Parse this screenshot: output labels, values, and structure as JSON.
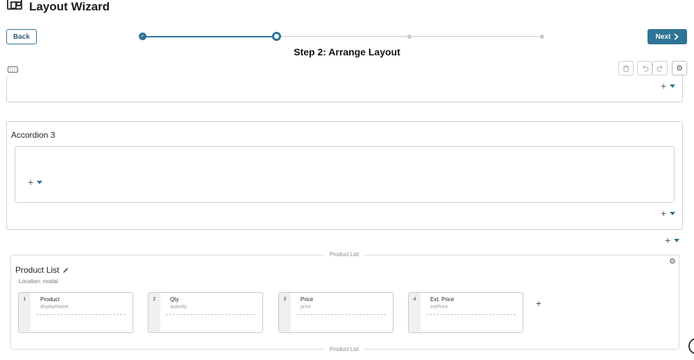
{
  "app": {
    "title": "Layout Wizard",
    "icon": "layout-icon"
  },
  "nav": {
    "back_label": "Back",
    "next_label": "Next",
    "next_icon": "chevron-right-icon"
  },
  "stepper": {
    "current_step_title": "Step 2: Arrange Layout",
    "total_steps": 4,
    "current_step": 2
  },
  "toolbar": {
    "keyboard_icon": "keyboard-icon",
    "buttons": [
      {
        "icon": "trash-icon",
        "enabled": false
      },
      {
        "icon": "undo-icon",
        "enabled": false
      },
      {
        "icon": "redo-icon",
        "enabled": false
      },
      {
        "icon": "gear-icon",
        "enabled": true
      }
    ]
  },
  "add_glyph": "+",
  "accordion": {
    "title": "Accordion 3"
  },
  "product_list": {
    "divider_label": "Product List",
    "title": "Product List",
    "location": "Location: modal",
    "columns": [
      {
        "index": "1",
        "name": "Product",
        "key": "displayName"
      },
      {
        "index": "2",
        "name": "Qty",
        "key": "quantity"
      },
      {
        "index": "3",
        "name": "Price",
        "key": "price"
      },
      {
        "index": "4",
        "name": "Ext. Price",
        "key": "extPrice"
      }
    ]
  },
  "colors": {
    "accent": "#2f7396",
    "border": "#cfcfcf",
    "muted_text": "#888888"
  }
}
